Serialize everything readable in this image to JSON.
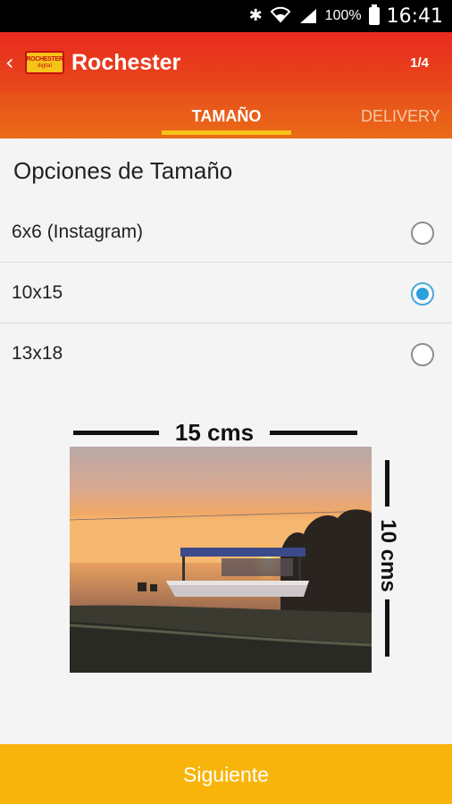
{
  "status_bar": {
    "battery_text": "100%",
    "time": "16:41"
  },
  "app_bar": {
    "title": "Rochester",
    "logo_line1": "ROCHESTER",
    "logo_line2": "digital",
    "page_count": "1/4"
  },
  "tabs": [
    {
      "label": "TAMAÑO",
      "active": true
    },
    {
      "label": "DELIVERY",
      "active": false
    }
  ],
  "section_title": "Opciones de Tamaño",
  "options": [
    {
      "label": "6x6 (Instagram)",
      "selected": false
    },
    {
      "label": "10x15",
      "selected": true
    },
    {
      "label": "13x18",
      "selected": false
    }
  ],
  "illustration": {
    "width_label": "15 cms",
    "height_label": "10 cms"
  },
  "next_button": {
    "label": "Siguiente"
  },
  "colors": {
    "app_bar": "#e82a1f",
    "tabs": "#ea6a17",
    "tab_indicator": "#f7c21a",
    "radio_selected": "#2ca0dc",
    "next_button": "#f8b40a"
  }
}
